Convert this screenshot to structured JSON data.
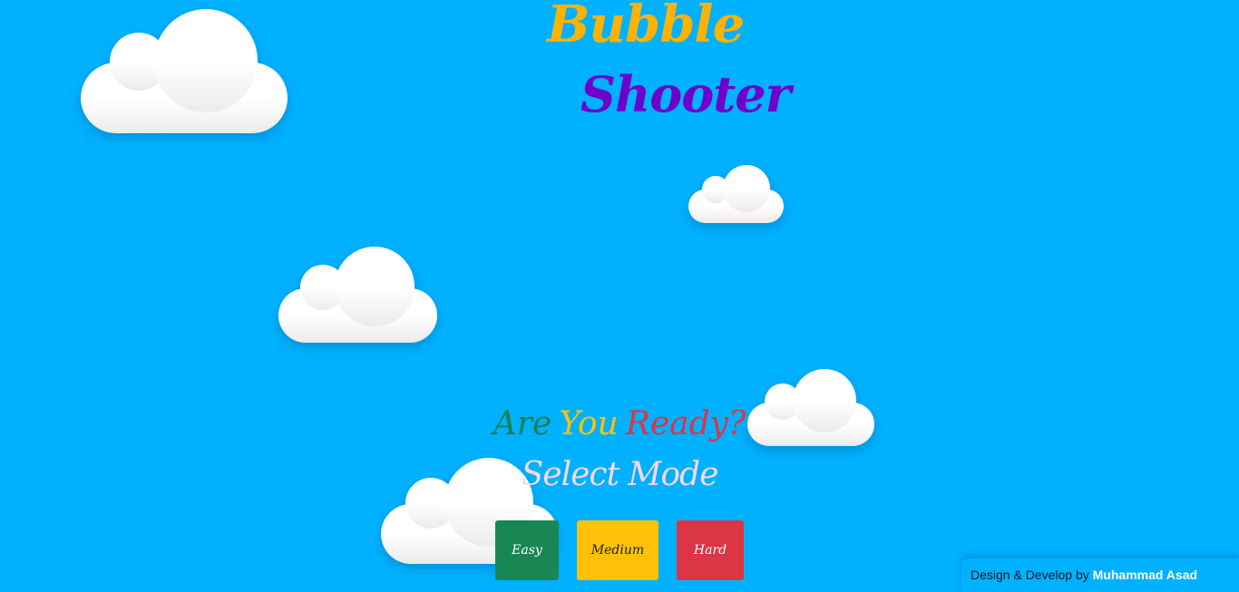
{
  "title": {
    "line1": "Bubble",
    "line2": "Shooter"
  },
  "prompt": {
    "words": [
      "Are",
      "You",
      "Ready?"
    ],
    "subtitle": "Select Mode"
  },
  "modes": {
    "easy": "Easy",
    "medium": "Medium",
    "hard": "Hard"
  },
  "credit": {
    "prefix": "Design & Develop by",
    "author": "Muhammad Asad"
  },
  "colors": {
    "background": "#00b1ff",
    "title_bubble": "#ffb300",
    "title_shooter": "#6f00cc",
    "easy": "#198754",
    "medium": "#ffc107",
    "hard": "#dc3545",
    "subtitle": "#f8d7e8"
  },
  "icons": [
    "cloud-icon"
  ]
}
